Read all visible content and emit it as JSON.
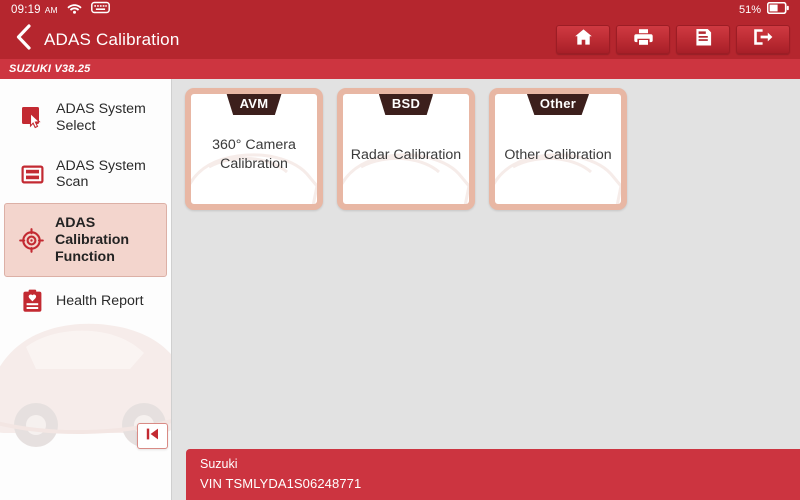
{
  "statusbar": {
    "time": "09:19",
    "ampm": "AM",
    "wifi_icon": "wifi-icon",
    "keyboard_icon": "keyboard-icon",
    "battery_percent": "51%",
    "battery_icon": "battery-half-icon"
  },
  "header": {
    "back_icon": "back-chevron-icon",
    "title": "ADAS Calibration",
    "toolbar": [
      {
        "name": "home-button",
        "icon": "home-icon"
      },
      {
        "name": "print-button",
        "icon": "printer-icon"
      },
      {
        "name": "report-button",
        "icon": "document-report-icon"
      },
      {
        "name": "exit-button",
        "icon": "exit-icon"
      }
    ]
  },
  "version_strip": {
    "label": "SUZUKI V38.25"
  },
  "sidebar": {
    "items": [
      {
        "label": "ADAS System Select",
        "icon": "cursor-select-icon",
        "active": false
      },
      {
        "label": "ADAS System Scan",
        "icon": "scan-icon",
        "active": false
      },
      {
        "label": "ADAS Calibration Function",
        "icon": "crosshair-target-icon",
        "active": true
      },
      {
        "label": "Health Report",
        "icon": "clipboard-health-icon",
        "active": false
      }
    ],
    "collapse_button": {
      "icon": "collapse-left-icon",
      "label": "|◀"
    }
  },
  "main": {
    "cards": [
      {
        "badge": "AVM",
        "label": "360° Camera Calibration"
      },
      {
        "badge": "BSD",
        "label": "Radar Calibration"
      },
      {
        "badge": "Other",
        "label": "Other Calibration"
      }
    ]
  },
  "vehicle": {
    "make": "Suzuki",
    "vin": "VIN TSMLYDA1S06248771"
  },
  "colors": {
    "header_red": "#b5262e",
    "strip_red": "#cd3540",
    "vehicle_red": "#cc3440",
    "card_border": "#e8b7a4",
    "badge_dark": "#3c1f1c",
    "active_item_bg": "#f3d5cd",
    "content_bg": "#e2e2e2",
    "icon_red": "#c32a32"
  }
}
